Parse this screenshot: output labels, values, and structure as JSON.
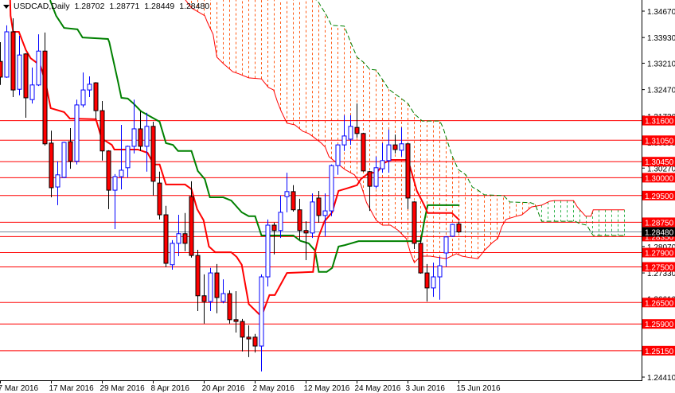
{
  "header": {
    "symbol_timeframe": "USDCAD,Daily",
    "open": "1.28702",
    "high": "1.28771",
    "low": "1.28449",
    "close": "1.28480"
  },
  "colors": {
    "bull": "#0000ff",
    "bear_fill": "#ff0000",
    "bear_wick": "#000000",
    "tenkan": "#ff0000",
    "kijun": "#008000",
    "span_a": "#ff0000",
    "span_b": "#008000",
    "cloud_bear": "#ff5a14",
    "cloud_bull": "#2db34a",
    "level_line": "#ff0000",
    "price_line": "#778899"
  },
  "chart_data": {
    "type": "candlestick",
    "title": "USDCAD,Daily",
    "ylim": [
      1.2441,
      1.3467
    ],
    "current_price": 1.2848,
    "current_price_label": "1.28480",
    "y_tick_labels": [
      "1.34670",
      "1.33930",
      "1.33210",
      "1.32470",
      "1.31730",
      "1.30990",
      "1.30270",
      "1.29550",
      "1.28810",
      "1.28070",
      "1.27330",
      "1.26610",
      "1.25870",
      "1.25150",
      "1.24410"
    ],
    "x_tick_labels": [
      {
        "label": "7 Mar 2016",
        "index": 0
      },
      {
        "label": "17 Mar 2016",
        "index": 8
      },
      {
        "label": "29 Mar 2016",
        "index": 16
      },
      {
        "label": "8 Apr 2016",
        "index": 24
      },
      {
        "label": "20 Apr 2016",
        "index": 32
      },
      {
        "label": "2 May 2016",
        "index": 40
      },
      {
        "label": "12 May 2016",
        "index": 48
      },
      {
        "label": "24 May 2016",
        "index": 56
      },
      {
        "label": "3 Jun 2016",
        "index": 64
      },
      {
        "label": "15 Jun 2016",
        "index": 72
      }
    ],
    "levels": [
      {
        "price": 1.316,
        "label": "1.31600"
      },
      {
        "price": 1.3105,
        "label": "1.31050"
      },
      {
        "price": 1.3045,
        "label": "1.30450"
      },
      {
        "price": 1.3,
        "label": "1.30000"
      },
      {
        "price": 1.295,
        "label": "1.29500"
      },
      {
        "price": 1.2875,
        "label": "1.28750"
      },
      {
        "price": 1.2835,
        "label": "1.28350"
      },
      {
        "price": 1.279,
        "label": "1.27900"
      },
      {
        "price": 1.275,
        "label": "1.27500"
      },
      {
        "price": 1.265,
        "label": "1.26500"
      },
      {
        "price": 1.259,
        "label": "1.25900"
      },
      {
        "price": 1.2515,
        "label": "1.25150"
      }
    ],
    "ohlc": [
      [
        1.3326,
        1.338,
        1.326,
        1.3282
      ],
      [
        1.3282,
        1.3427,
        1.328,
        1.3409
      ],
      [
        1.3409,
        1.3447,
        1.3226,
        1.3246
      ],
      [
        1.3248,
        1.3398,
        1.3231,
        1.3344
      ],
      [
        1.3347,
        1.3349,
        1.3168,
        1.3224
      ],
      [
        1.3219,
        1.3309,
        1.3208,
        1.326
      ],
      [
        1.326,
        1.3402,
        1.3257,
        1.3355
      ],
      [
        1.3355,
        1.3407,
        1.309,
        1.3095
      ],
      [
        1.3097,
        1.3132,
        1.2945,
        1.2972
      ],
      [
        1.2974,
        1.3046,
        1.2923,
        1.3008
      ],
      [
        1.3001,
        1.3101,
        1.2999,
        1.3099
      ],
      [
        1.3101,
        1.3139,
        1.3025,
        1.3046
      ],
      [
        1.3046,
        1.3219,
        1.3037,
        1.3204
      ],
      [
        1.3204,
        1.3295,
        1.3197,
        1.3246
      ],
      [
        1.3246,
        1.3284,
        1.3226,
        1.3262
      ],
      [
        1.3266,
        1.3268,
        1.3164,
        1.3188
      ],
      [
        1.3188,
        1.3215,
        1.3048,
        1.3075
      ],
      [
        1.3075,
        1.3077,
        1.2912,
        1.2965
      ],
      [
        1.2965,
        1.301,
        1.2856,
        1.3003
      ],
      [
        1.3003,
        1.3148,
        1.2967,
        1.3021
      ],
      [
        1.3028,
        1.309,
        1.3001,
        1.3088
      ],
      [
        1.3088,
        1.3219,
        1.3068,
        1.3137
      ],
      [
        1.3137,
        1.3186,
        1.3075,
        1.3088
      ],
      [
        1.3088,
        1.3182,
        1.3017,
        1.3144
      ],
      [
        1.3144,
        1.3157,
        1.295,
        1.299
      ],
      [
        1.2985,
        1.3017,
        1.2883,
        1.2896
      ],
      [
        1.2896,
        1.2921,
        1.2749,
        1.276
      ],
      [
        1.2756,
        1.2825,
        1.2742,
        1.2816
      ],
      [
        1.2816,
        1.2896,
        1.278,
        1.2843
      ],
      [
        1.2843,
        1.2901,
        1.2794,
        1.2816
      ],
      [
        1.2947,
        1.299,
        1.2776,
        1.2782
      ],
      [
        1.2782,
        1.2798,
        1.2626,
        1.2669
      ],
      [
        1.2669,
        1.2729,
        1.2591,
        1.2653
      ],
      [
        1.2653,
        1.2747,
        1.2626,
        1.2733
      ],
      [
        1.2733,
        1.2758,
        1.262,
        1.2664
      ],
      [
        1.2653,
        1.2715,
        1.2648,
        1.2675
      ],
      [
        1.2675,
        1.2684,
        1.2591,
        1.2602
      ],
      [
        1.2602,
        1.2682,
        1.2566,
        1.2597
      ],
      [
        1.2597,
        1.2604,
        1.2513,
        1.2553
      ],
      [
        1.2553,
        1.2586,
        1.2497,
        1.2548
      ],
      [
        1.2553,
        1.2562,
        1.251,
        1.2528
      ],
      [
        1.2528,
        1.2729,
        1.2457,
        1.2722
      ],
      [
        1.2722,
        1.2883,
        1.2695,
        1.2867
      ],
      [
        1.2867,
        1.2874,
        1.2785,
        1.2852
      ],
      [
        1.2852,
        1.295,
        1.2831,
        1.2903
      ],
      [
        1.2947,
        1.3014,
        1.2903,
        1.2961
      ],
      [
        1.2961,
        1.2979,
        1.2905,
        1.291
      ],
      [
        1.291,
        1.2941,
        1.2827,
        1.2852
      ],
      [
        1.2852,
        1.2878,
        1.2769,
        1.2845
      ],
      [
        1.2845,
        1.2956,
        1.2831,
        1.2932
      ],
      [
        1.2943,
        1.2963,
        1.2874,
        1.2894
      ],
      [
        1.2894,
        1.2956,
        1.2836,
        1.2907
      ],
      [
        1.2907,
        1.3037,
        1.2892,
        1.3034
      ],
      [
        1.3034,
        1.3094,
        1.3008,
        1.3092
      ],
      [
        1.3092,
        1.3175,
        1.3075,
        1.3117
      ],
      [
        1.3108,
        1.3175,
        1.3092,
        1.3144
      ],
      [
        1.3141,
        1.3208,
        1.3112,
        1.3124
      ],
      [
        1.3124,
        1.3126,
        1.3017,
        1.3019
      ],
      [
        1.3017,
        1.3019,
        1.2907,
        1.2976
      ],
      [
        1.2976,
        1.3059,
        1.297,
        1.3028
      ],
      [
        1.3025,
        1.3097,
        1.3014,
        1.3048
      ],
      [
        1.3048,
        1.3135,
        1.3014,
        1.3092
      ],
      [
        1.3092,
        1.3121,
        1.3068,
        1.3079
      ],
      [
        1.3077,
        1.3141,
        1.3059,
        1.3095
      ],
      [
        1.3095,
        1.3097,
        1.2912,
        1.2943
      ],
      [
        1.2932,
        1.2934,
        1.28,
        1.2816
      ],
      [
        1.2816,
        1.2834,
        1.2731,
        1.2733
      ],
      [
        1.2733,
        1.2758,
        1.2653,
        1.2691
      ],
      [
        1.2691,
        1.2762,
        1.2666,
        1.2722
      ],
      [
        1.2722,
        1.2778,
        1.2658,
        1.2753
      ],
      [
        1.2789,
        1.2836,
        1.2751,
        1.2834
      ],
      [
        1.2836,
        1.2871,
        1.2834,
        1.2869
      ],
      [
        1.28702,
        1.28771,
        1.28449,
        1.2848
      ]
    ],
    "tenkan": [
      [
        1.5,
        1.352
      ],
      [
        1.6,
        1.3454
      ],
      [
        2,
        1.3409
      ],
      [
        2.9,
        1.3409
      ],
      [
        4,
        1.3358
      ],
      [
        4.75,
        1.3335
      ],
      [
        6.25,
        1.3315
      ],
      [
        6.6,
        1.3297
      ],
      [
        7.25,
        1.3253
      ],
      [
        7.9,
        1.3195
      ],
      [
        10,
        1.3184
      ],
      [
        10.9,
        1.3166
      ],
      [
        15,
        1.3164
      ],
      [
        15.9,
        1.311
      ],
      [
        17.5,
        1.3092
      ],
      [
        17.9,
        1.3079
      ],
      [
        21.6,
        1.3079
      ],
      [
        23.1,
        1.307
      ],
      [
        24.1,
        1.3037
      ],
      [
        25,
        1.3037
      ],
      [
        26,
        1.2981
      ],
      [
        29,
        1.2981
      ],
      [
        30,
        1.2968
      ],
      [
        30.9,
        1.2912
      ],
      [
        31.9,
        1.2881
      ],
      [
        32.75,
        1.2807
      ],
      [
        33.75,
        1.2791
      ],
      [
        36.25,
        1.2791
      ],
      [
        37.1,
        1.2778
      ],
      [
        37.9,
        1.2756
      ],
      [
        39,
        1.2646
      ],
      [
        41,
        1.2611
      ],
      [
        41.5,
        1.2635
      ],
      [
        42.25,
        1.2671
      ],
      [
        43.1,
        1.2671
      ],
      [
        45,
        1.2733
      ],
      [
        49.1,
        1.2736
      ],
      [
        49.4,
        1.2791
      ],
      [
        50,
        1.2836
      ],
      [
        50.9,
        1.2878
      ],
      [
        52.1,
        1.2903
      ],
      [
        53.1,
        1.2963
      ],
      [
        54.4,
        1.297
      ],
      [
        56,
        1.2979
      ],
      [
        56.6,
        1.2996
      ],
      [
        57.9,
        1.3014
      ],
      [
        59.1,
        1.3014
      ],
      [
        60.25,
        1.3041
      ],
      [
        61.25,
        1.305
      ],
      [
        64,
        1.305
      ],
      [
        64.6,
        1.3014
      ],
      [
        65.4,
        1.2963
      ],
      [
        66.5,
        1.2925
      ],
      [
        67.1,
        1.2901
      ],
      [
        70.9,
        1.2901
      ],
      [
        72.1,
        1.2881
      ]
    ],
    "kijun": [
      [
        7.8,
        1.3498
      ],
      [
        8.75,
        1.3454
      ],
      [
        10,
        1.342
      ],
      [
        12.1,
        1.3416
      ],
      [
        12.9,
        1.3393
      ],
      [
        16.9,
        1.3389
      ],
      [
        17.1,
        1.338
      ],
      [
        18.4,
        1.3275
      ],
      [
        19,
        1.3224
      ],
      [
        20,
        1.3222
      ],
      [
        20.9,
        1.3208
      ],
      [
        22.1,
        1.3186
      ],
      [
        25,
        1.3157
      ],
      [
        26,
        1.3097
      ],
      [
        27.1,
        1.3092
      ],
      [
        27.9,
        1.3075
      ],
      [
        30,
        1.3075
      ],
      [
        31,
        1.3019
      ],
      [
        32.1,
        1.2996
      ],
      [
        32.9,
        1.2945
      ],
      [
        35,
        1.2945
      ],
      [
        36.25,
        1.2936
      ],
      [
        37.9,
        1.2903
      ],
      [
        39,
        1.2892
      ],
      [
        40,
        1.2892
      ],
      [
        41,
        1.2838
      ],
      [
        46,
        1.2838
      ],
      [
        47.1,
        1.2823
      ],
      [
        48.4,
        1.2816
      ],
      [
        49.4,
        1.2796
      ],
      [
        50,
        1.2736
      ],
      [
        51.25,
        1.2736
      ],
      [
        52.1,
        1.2747
      ],
      [
        53.1,
        1.2807
      ],
      [
        54.1,
        1.2811
      ],
      [
        56.25,
        1.2822
      ],
      [
        66,
        1.2822
      ],
      [
        66.6,
        1.2881
      ],
      [
        67.1,
        1.2923
      ],
      [
        72.1,
        1.2923
      ]
    ],
    "span_a": [
      [
        26,
        1.356
      ],
      [
        29,
        1.35
      ],
      [
        30,
        1.3476
      ],
      [
        32.1,
        1.3454
      ],
      [
        32.5,
        1.3436
      ],
      [
        33.4,
        1.3402
      ],
      [
        34,
        1.3338
      ],
      [
        35,
        1.332
      ],
      [
        36.5,
        1.3297
      ],
      [
        37.5,
        1.3291
      ],
      [
        39,
        1.328
      ],
      [
        41,
        1.3277
      ],
      [
        42.1,
        1.3253
      ],
      [
        42.9,
        1.3246
      ],
      [
        43.5,
        1.3213
      ],
      [
        44.1,
        1.3186
      ],
      [
        45,
        1.3153
      ],
      [
        46.25,
        1.3148
      ],
      [
        47.5,
        1.313
      ],
      [
        48.4,
        1.3124
      ],
      [
        49.1,
        1.3115
      ],
      [
        50.4,
        1.3097
      ],
      [
        51,
        1.3086
      ],
      [
        51.6,
        1.3059
      ],
      [
        54.1,
        1.3023
      ],
      [
        55.6,
        1.3008
      ],
      [
        56.6,
        1.2981
      ],
      [
        57.5,
        1.293
      ],
      [
        59,
        1.2881
      ],
      [
        60,
        1.2867
      ],
      [
        61.25,
        1.2867
      ],
      [
        62.5,
        1.2852
      ],
      [
        63.75,
        1.2829
      ],
      [
        64.4,
        1.2789
      ],
      [
        65,
        1.2762
      ],
      [
        66,
        1.278
      ],
      [
        67.5,
        1.278
      ],
      [
        70,
        1.2773
      ],
      [
        71.6,
        1.2787
      ],
      [
        72.5,
        1.278
      ],
      [
        73.75,
        1.2776
      ],
      [
        75,
        1.2773
      ],
      [
        76,
        1.2796
      ],
      [
        77.25,
        1.2818
      ],
      [
        78.1,
        1.2829
      ],
      [
        78.75,
        1.2863
      ],
      [
        79.4,
        1.2883
      ],
      [
        81,
        1.2892
      ],
      [
        81.9,
        1.2896
      ],
      [
        83.4,
        1.2918
      ],
      [
        85,
        1.2923
      ],
      [
        86.25,
        1.2934
      ],
      [
        87,
        1.2936
      ],
      [
        90,
        1.2936
      ],
      [
        90.6,
        1.2918
      ],
      [
        91.9,
        1.2892
      ],
      [
        92.75,
        1.2892
      ],
      [
        93.1,
        1.291
      ],
      [
        98,
        1.291
      ]
    ],
    "span_b": [
      [
        26,
        1.36
      ],
      [
        49.75,
        1.3498
      ],
      [
        51.25,
        1.3454
      ],
      [
        52,
        1.3427
      ],
      [
        54,
        1.3425
      ],
      [
        55,
        1.338
      ],
      [
        56,
        1.3338
      ],
      [
        57,
        1.3324
      ],
      [
        58,
        1.3304
      ],
      [
        59,
        1.3302
      ],
      [
        60,
        1.3275
      ],
      [
        61,
        1.3248
      ],
      [
        64,
        1.3208
      ],
      [
        65,
        1.3179
      ],
      [
        66.25,
        1.3159
      ],
      [
        69,
        1.3159
      ],
      [
        69.5,
        1.3141
      ],
      [
        70.9,
        1.3063
      ],
      [
        71.9,
        1.3023
      ],
      [
        73.1,
        1.3008
      ],
      [
        74.1,
        1.2974
      ],
      [
        75,
        1.2965
      ],
      [
        76,
        1.2952
      ],
      [
        79,
        1.295
      ],
      [
        80,
        1.2932
      ],
      [
        83.25,
        1.293
      ],
      [
        84,
        1.2925
      ],
      [
        84.75,
        1.2889
      ],
      [
        85,
        1.2878
      ],
      [
        90.25,
        1.2878
      ],
      [
        91,
        1.2871
      ],
      [
        92.1,
        1.2867
      ],
      [
        92.75,
        1.2847
      ],
      [
        93.1,
        1.2838
      ],
      [
        98,
        1.2838
      ]
    ]
  }
}
